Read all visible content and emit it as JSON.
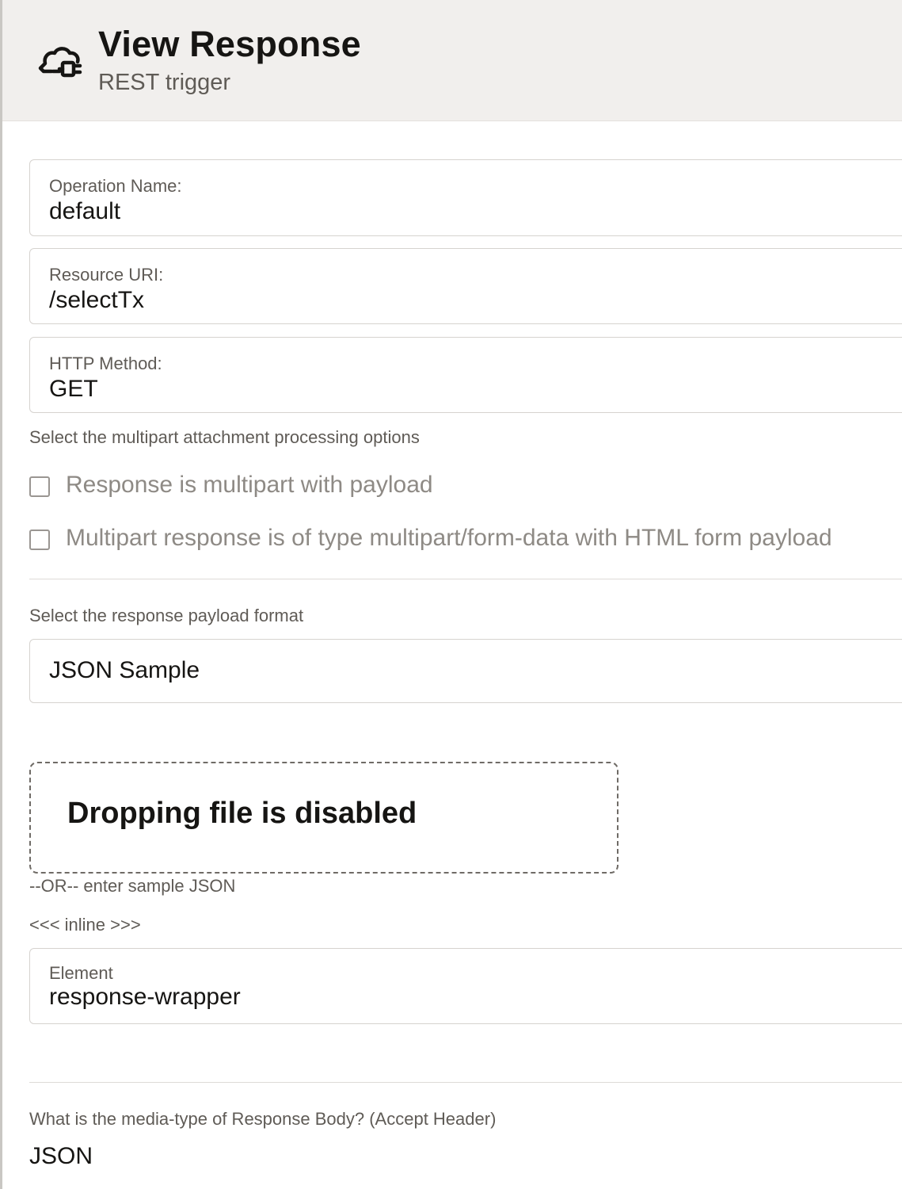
{
  "header": {
    "title": "View Response",
    "subtitle": "REST trigger",
    "icon": "cloud-plug-icon"
  },
  "fields": {
    "operation_name": {
      "label": "Operation Name:",
      "value": "default"
    },
    "resource_uri": {
      "label": "Resource URI:",
      "value": "/selectTx"
    },
    "http_method": {
      "label": "HTTP Method:",
      "value": "GET"
    }
  },
  "multipart": {
    "section_label": "Select the multipart attachment processing options",
    "options": [
      {
        "label": "Response is multipart with payload",
        "checked": false
      },
      {
        "label": "Multipart response is of type multipart/form-data with HTML form payload",
        "checked": false
      }
    ]
  },
  "payload_format": {
    "section_label": "Select the response payload format",
    "selected": "JSON Sample"
  },
  "dropzone": {
    "text": "Dropping file is disabled"
  },
  "sample": {
    "or_text": "--OR-- enter sample JSON",
    "inline_link": "<<< inline >>>"
  },
  "element": {
    "label": "Element",
    "value": "response-wrapper"
  },
  "media_type": {
    "question": "What is the media-type of Response Body? (Accept Header)",
    "value": "JSON"
  }
}
